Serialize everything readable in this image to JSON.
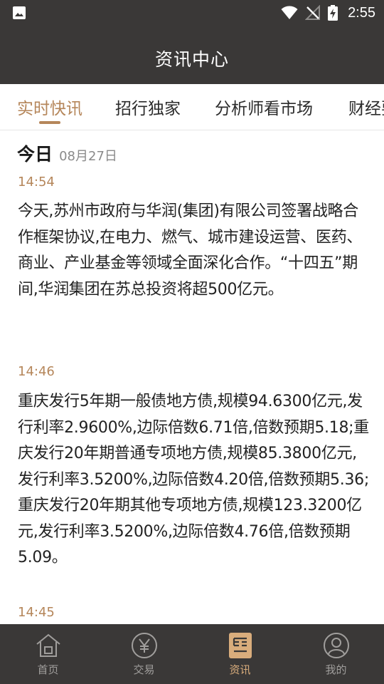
{
  "status_bar": {
    "time": "2:55"
  },
  "header": {
    "title": "资讯中心"
  },
  "tabs": [
    {
      "label": "实时快讯"
    },
    {
      "label": "招行独家"
    },
    {
      "label": "分析师看市场"
    },
    {
      "label": "财经要闻"
    }
  ],
  "feed": {
    "date_label": "今日",
    "date_value": "08月27日",
    "items": [
      {
        "time": "14:54",
        "text": "今天,苏州市政府与华润(集团)有限公司签署战略合作框架协议,在电力、燃气、城市建设运营、医药、商业、产业基金等领域全面深化合作。“十四五”期间,华润集团在苏总投资将超500亿元。"
      },
      {
        "time": "14:46",
        "text": "重庆发行5年期一般债地方债,规模94.6300亿元,发行利率2.9600%,边际倍数6.71倍,倍数预期5.18;重庆发行20年期普通专项地方债,规模85.3800亿元,发行利率3.5200%,边际倍数4.20倍,倍数预期5.36;重庆发行20年期其他专项地方债,规模123.3200亿元,发行利率3.5200%,边际倍数4.76倍,倍数预期5.09。"
      },
      {
        "time": "14:45",
        "text": ""
      }
    ]
  },
  "bottom_nav": [
    {
      "label": "首页",
      "icon": "home-icon"
    },
    {
      "label": "交易",
      "icon": "yen-icon"
    },
    {
      "label": "资讯",
      "icon": "news-icon"
    },
    {
      "label": "我的",
      "icon": "profile-icon"
    }
  ],
  "colors": {
    "bar_bg": "#3a3837",
    "accent": "#b5865a",
    "nav_active": "#d9ad7c",
    "nav_inactive": "#a09e9c"
  }
}
